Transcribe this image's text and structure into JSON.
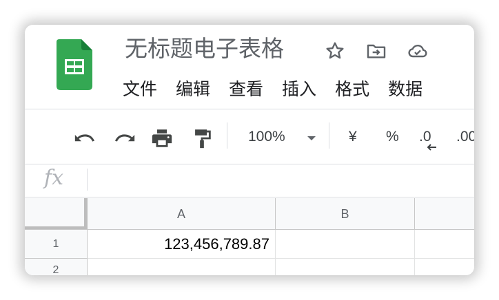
{
  "app": {
    "doc_title": "无标题电子表格",
    "brand_color": "#34a853"
  },
  "menu": [
    "文件",
    "编辑",
    "查看",
    "插入",
    "格式",
    "数据"
  ],
  "toolbar": {
    "zoom": "100%",
    "currency": "¥",
    "percent": "%",
    "decrease_decimal": ".0",
    "increase_decimal": ".00"
  },
  "formula_bar": {
    "label": "fx",
    "value": ""
  },
  "grid": {
    "columns": [
      "A",
      "B"
    ],
    "rows": [
      "1",
      "2"
    ],
    "cells": {
      "A1": "123,456,789.87",
      "B1": "",
      "A2": "",
      "B2": ""
    }
  }
}
